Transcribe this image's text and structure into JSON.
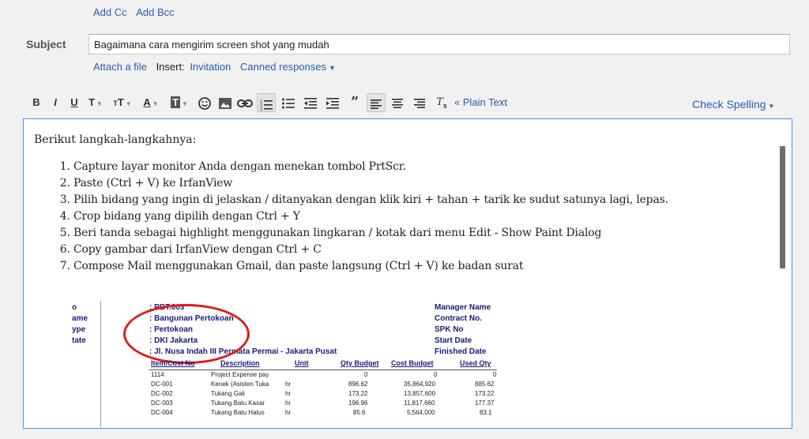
{
  "header": {
    "add_cc": "Add Cc",
    "add_bcc": "Add Bcc",
    "subject_label": "Subject",
    "subject_value": "Bagaimana cara mengirim screen shot yang mudah",
    "attach_file": "Attach a file",
    "insert_label": "Insert:",
    "invitation": "Invitation",
    "canned_responses": "Canned responses"
  },
  "toolbar": {
    "bold": "B",
    "italic": "I",
    "underline": "U",
    "font": "T",
    "size": "T",
    "text_color": "A",
    "highlight": "T",
    "plain_text": "« Plain Text",
    "check_spelling": "Check Spelling"
  },
  "body": {
    "intro": "Berikut langkah-langkahnya:",
    "steps": [
      "Capture layar monitor Anda dengan menekan tombol PrtScr.",
      "Paste (Ctrl + V) ke IrfanView",
      "Pilih bidang yang ingin di jelaskan / ditanyakan dengan klik kiri + tahan + tarik ke sudut satunya lagi, lepas.",
      "Crop bidang yang dipilih dengan Ctrl + Y",
      "Beri tanda sebagai highlight menggunakan lingkaran / kotak dari menu Edit - Show Paint Dialog",
      "Copy gambar dari IrfanView dengan Ctrl + C",
      "Compose Mail menggunakan Gmail, dan paste langsung (Ctrl + V) ke badan surat"
    ]
  },
  "screenshot": {
    "left_labels": [
      "o",
      "ame",
      "ype",
      "tate"
    ],
    "values": [
      ": PBT.003",
      ": Bangunan Pertokoan",
      ": Pertokoan",
      ": DKI Jakarta",
      ": Jl. Nusa Indah III Permata Permai - Jakarta Pusat"
    ],
    "right_labels": [
      "Manager Name",
      "Contract No.",
      "SPK No",
      "Start Date",
      "Finished Date"
    ],
    "columns": [
      "Item/Cost No",
      "Description",
      "Unit",
      "Qty Budget",
      "Cost Budget",
      "Used Qty"
    ],
    "rows": [
      [
        "1114",
        "Project Expense pay",
        "",
        "0",
        "0",
        "0"
      ],
      [
        "DC-001",
        "Kenek (Asisten Tuka",
        "hr",
        "896.62",
        "35,864,920",
        "885.62"
      ],
      [
        "DC-002",
        "Tukang Gali",
        "hr",
        "173.22",
        "13,857,600",
        "173.22"
      ],
      [
        "DC-003",
        "Tukang Batu Kasar",
        "hr",
        "196.96",
        "11,817,660",
        "177.37"
      ],
      [
        "DC-004",
        "Tukang Batu Halus",
        "hr",
        "85.6",
        "5,564,000",
        "83.1"
      ]
    ]
  },
  "colors": {
    "link": "#2a5db0",
    "focus_border": "#4d90fe",
    "highlight_circle": "#e01b1b"
  }
}
